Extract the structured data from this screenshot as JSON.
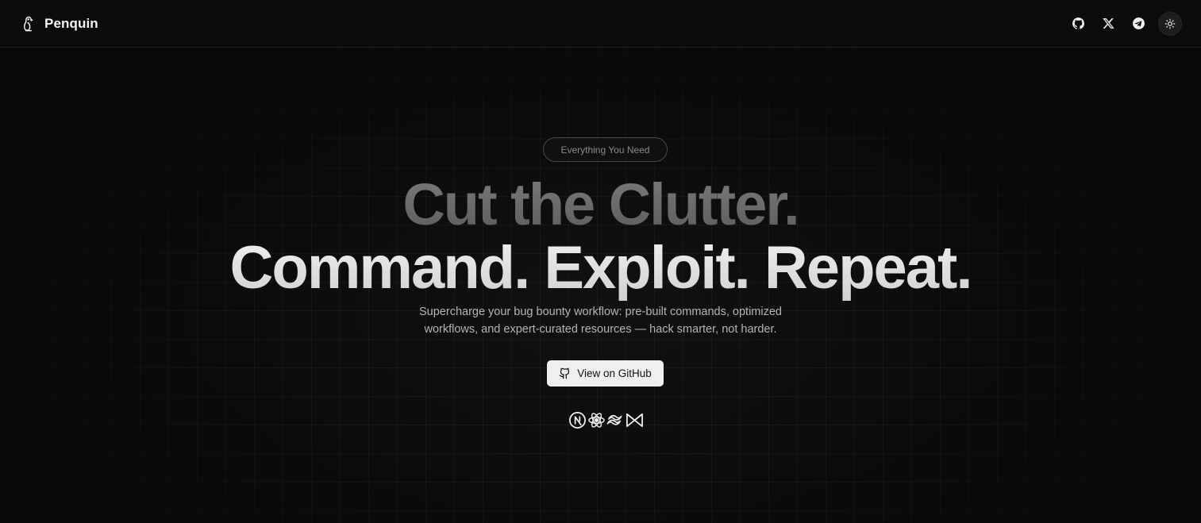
{
  "header": {
    "brand_name": "Penquin",
    "nav_icons": [
      "github-icon",
      "x-icon",
      "telegram-icon",
      "sun-icon"
    ]
  },
  "hero": {
    "badge": "Everything You Need",
    "headline_line1": "Cut the Clutter.",
    "headline_line2": "Command. Exploit. Repeat.",
    "subtext_line1": "Supercharge your bug bounty workflow: pre-built commands, optimized",
    "subtext_line2": "workflows, and expert-curated resources — hack smarter, not harder.",
    "cta_label": "View on GitHub",
    "tech_icons": [
      "nextjs-icon",
      "react-icon",
      "tailwind-icon",
      "motion-icon"
    ]
  },
  "colors": {
    "background": "#0a0a0a",
    "cta_background": "#efefef",
    "headline_dim": "#6a6a6a",
    "headline_bright": "#e6e6e6"
  }
}
